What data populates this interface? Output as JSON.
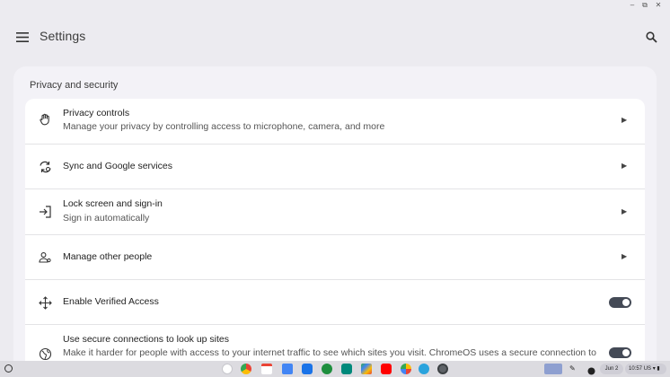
{
  "window": {
    "controls": {
      "minimize": "–",
      "restore": "⧉",
      "close": "✕"
    }
  },
  "header": {
    "title": "Settings",
    "menu_icon": "hamburger-menu-icon",
    "search_icon": "search-icon"
  },
  "section": {
    "title": "Privacy and security",
    "items": [
      {
        "icon": "hand-icon",
        "title": "Privacy controls",
        "subtitle": "Manage your privacy by controlling access to microphone, camera, and more",
        "control": "chevron"
      },
      {
        "icon": "sync-icon",
        "title": "Sync and Google services",
        "subtitle": "",
        "control": "chevron"
      },
      {
        "icon": "login-icon",
        "title": "Lock screen and sign-in",
        "subtitle": "Sign in automatically",
        "control": "chevron"
      },
      {
        "icon": "people-icon",
        "title": "Manage other people",
        "subtitle": "",
        "control": "chevron"
      },
      {
        "icon": "move-icon",
        "title": "Enable Verified Access",
        "subtitle": "",
        "control": "toggle",
        "toggle_on": true
      },
      {
        "icon": "globe-icon",
        "title": "Use secure connections to look up sites",
        "subtitle": "Make it harder for people with access to your internet traffic to see which sites you visit. ChromeOS uses a secure connection to",
        "control": "toggle",
        "toggle_on": true
      }
    ]
  },
  "shelf": {
    "apps": [
      "assistant",
      "chrome",
      "gmail",
      "docs",
      "files",
      "chat",
      "meet",
      "play-store",
      "youtube",
      "photos",
      "telegram",
      "settings"
    ],
    "tray": {
      "date": "Jun 2",
      "time": "10:57",
      "locale": "US"
    }
  },
  "colors": {
    "background": "#ecebf0",
    "panel": "#f3f2f7",
    "card": "#ffffff",
    "toggle_on": "#444a56"
  }
}
